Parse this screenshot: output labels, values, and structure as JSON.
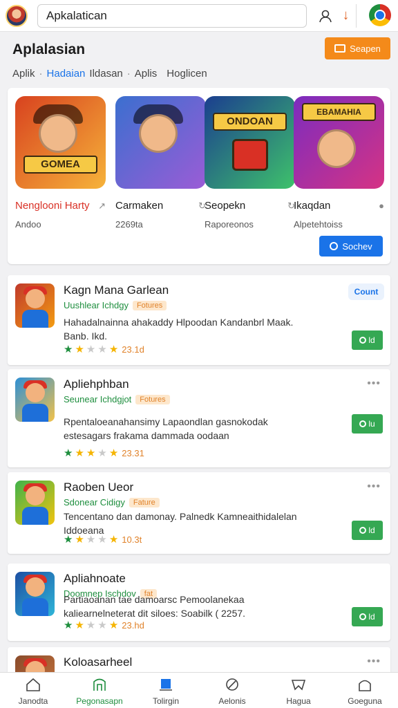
{
  "top_bar": {
    "search_value": "Apkalatican",
    "icons": [
      "avatar",
      "user-icon",
      "download-icon",
      "chrome-icon"
    ]
  },
  "header": {
    "title": "Aplalasian",
    "button_label": "Seapen"
  },
  "breadcrumb": [
    "Aplik",
    "Hadaian",
    "Ildasan",
    "Aplis",
    "Hoglicen"
  ],
  "featured": {
    "tiles": [
      {
        "name": "Nenglooni Harty",
        "sub": "Andoo",
        "art_text": "GOMEA",
        "colors": [
          "#d8421f",
          "#f6b33a"
        ],
        "name_color": "#d93025"
      },
      {
        "name": "Carmaken",
        "sub": "2269ta",
        "art_text": "",
        "colors": [
          "#3b6fcf",
          "#9b5cd6"
        ],
        "name_color": "#1b1b1b"
      },
      {
        "name": "Seopekn",
        "sub": "Raporeonos",
        "art_text": "ONDOAN",
        "colors": [
          "#1b3e8f",
          "#3ec26b"
        ],
        "name_color": "#1b1b1b"
      },
      {
        "name": "Ikaqdan",
        "sub": "Alpetehtoiss",
        "art_text": "EBAMAHIA",
        "colors": [
          "#7b2cbf",
          "#d63384"
        ],
        "name_color": "#1b1b1b"
      }
    ],
    "search_button": "Sochev"
  },
  "apps": [
    {
      "title": "Kagn Mana Garlean",
      "dev": "Uushlear Ichdgy",
      "tag": "Fotures",
      "desc": "Hahadalnainna ahakaddy Hlpoodan Kandanbrl Maak. Banb. Ikd.",
      "rating": "23.1d",
      "stars": [
        "green",
        "gold",
        "grey",
        "grey",
        "gold"
      ],
      "action": "install",
      "install_label": "ld",
      "badge": "Count",
      "icon_colors": [
        "#c0392b",
        "#f39c12"
      ]
    },
    {
      "title": "Apliehphban",
      "dev": "Seunear Ichdgjot",
      "tag": "Fotures",
      "desc": "Rpentaloeanahansimy Lapaondlan gasnokodak estesagars frakama dammada oodaan",
      "rating": "23.31",
      "stars": [
        "green",
        "gold",
        "gold",
        "grey",
        "gold"
      ],
      "action": "more",
      "install_label": "lu",
      "badge": "",
      "icon_colors": [
        "#2d8fd5",
        "#f3c24a"
      ]
    },
    {
      "title": "Raoben Ueor",
      "dev": "Sdonear Cidigy",
      "tag": "Fature",
      "desc": "Tencentano dan damonay. Palnedk Kamneaithidalelan Iddoeana",
      "rating": "10.3t",
      "stars": [
        "green",
        "gold",
        "grey",
        "grey",
        "gold"
      ],
      "action": "more",
      "install_label": "ld",
      "badge": "",
      "icon_colors": [
        "#3fb24a",
        "#f1c40f"
      ]
    },
    {
      "title": "Apliahnoate",
      "dev": "Doomnep Ischdov",
      "tag": "fat",
      "desc": "Partiaoanan tae damoarsc Pemoolanekaa kaliearnelneterat dit siloes: Soabilk ( 2257.",
      "rating": "23.hd",
      "stars": [
        "green",
        "gold",
        "grey",
        "grey",
        "gold"
      ],
      "action": "install",
      "install_label": "ld",
      "badge": "",
      "icon_colors": [
        "#1d4fa3",
        "#2fb5d8"
      ]
    },
    {
      "title": "Koloasarheel",
      "dev": "",
      "tag": "",
      "desc": "",
      "rating": "",
      "stars": [],
      "action": "more",
      "install_label": "",
      "badge": "",
      "icon_colors": [
        "#8a4b2b",
        "#c9773f"
      ]
    }
  ],
  "bottom_nav": [
    {
      "label": "Janodta",
      "icon": "home-icon",
      "active": false
    },
    {
      "label": "Pegonasapn",
      "icon": "apps-icon",
      "active": true
    },
    {
      "label": "Tolirgin",
      "icon": "library-icon",
      "active": false
    },
    {
      "label": "Aelonis",
      "icon": "edit-icon",
      "active": false
    },
    {
      "label": "Hagua",
      "icon": "mail-icon",
      "active": false
    },
    {
      "label": "Goeguna",
      "icon": "profile-icon",
      "active": false
    }
  ]
}
